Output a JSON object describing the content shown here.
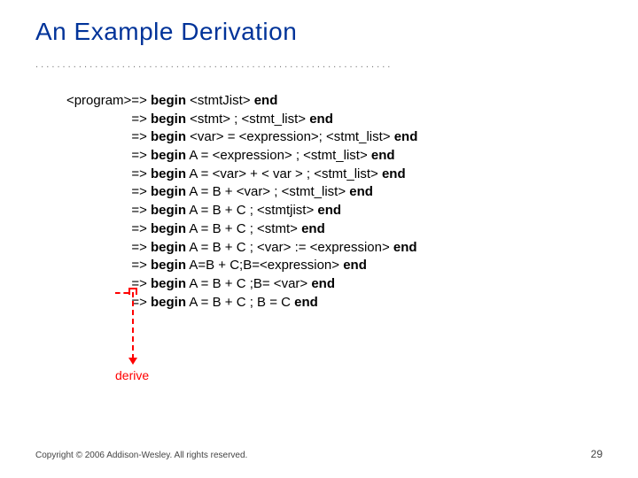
{
  "title": "An Example Derivation",
  "lines": [
    {
      "lhs": "<program>=> ",
      "begin": "begin",
      "mid": " <stmtJist> ",
      "end": "end",
      "tail": ""
    },
    {
      "lhs": "=> ",
      "begin": "begin",
      "mid": " <stmt> ; <stmt_list> ",
      "end": "end",
      "tail": ""
    },
    {
      "lhs": "=> ",
      "begin": "begin",
      "mid": " <var> = <expression>; <stmt_list> ",
      "end": "end",
      "tail": ""
    },
    {
      "lhs": "=> ",
      "begin": "begin",
      "mid": " A = <expression> ; <stmt_list> ",
      "end": "end",
      "tail": ""
    },
    {
      "lhs": "=> ",
      "begin": "begin",
      "mid": " A = <var> + < var > ; <stmt_list> ",
      "end": "end",
      "tail": ""
    },
    {
      "lhs": "=> ",
      "begin": "begin",
      "mid": " A = B + <var> ; <stmt_list> ",
      "end": "end",
      "tail": ""
    },
    {
      "lhs": "=> ",
      "begin": "begin",
      "mid": " A = B + C ; <stmtjist> ",
      "end": "end",
      "tail": ""
    },
    {
      "lhs": "=> ",
      "begin": "begin",
      "mid": " A = B + C ; <stmt> ",
      "end": "end",
      "tail": ""
    },
    {
      "lhs": "=> ",
      "begin": "begin",
      "mid": " A = B + C ; <var> := <expression> ",
      "end": "end",
      "tail": ""
    },
    {
      "lhs": "=> ",
      "begin": "begin",
      "mid": " A=B + C;B=<expression> ",
      "end": "end",
      "tail": ""
    },
    {
      "lhs": "=> ",
      "begin": "begin",
      "mid": " A = B + C ;B= <var> ",
      "end": "end",
      "tail": ""
    },
    {
      "lhs": "=> ",
      "begin": "begin",
      "mid": " A = B + C ; B = C ",
      "end": "end",
      "tail": ""
    }
  ],
  "derive": "derive",
  "copyright": "Copyright © 2006 Addison-Wesley. All rights reserved.",
  "page": "29",
  "dots": ". . . . . . . . . . . . . . . . . . . . . . . . . . . . . . . . . . . . . . . . . . . . . . . . . . . . . . . . . . . . . . . . . ."
}
